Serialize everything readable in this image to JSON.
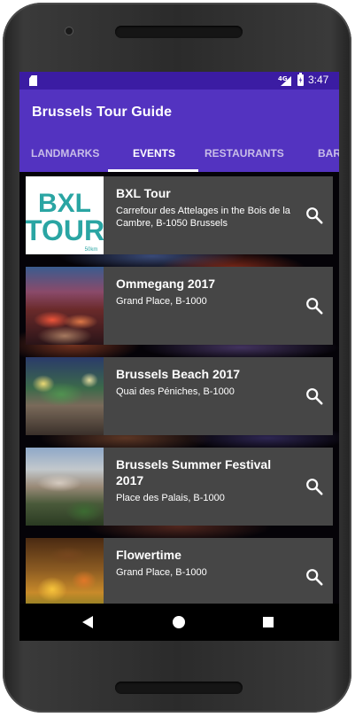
{
  "status_bar": {
    "network": "4G",
    "time": "3:47"
  },
  "app_bar": {
    "title": "Brussels Tour Guide"
  },
  "tabs": [
    {
      "label": "LANDMARKS",
      "active": false
    },
    {
      "label": "EVENTS",
      "active": true
    },
    {
      "label": "RESTAURANTS",
      "active": false
    },
    {
      "label": "BAR",
      "active": false
    }
  ],
  "events": [
    {
      "title": "BXL Tour",
      "address": "Carrefour des Attelages in the Bois de la Cambre, B-1050 Brussels",
      "thumb_logo": [
        "BXL",
        "TOUR",
        "50km"
      ]
    },
    {
      "title": "Ommegang 2017",
      "address": "Grand Place, B-1000"
    },
    {
      "title": "Brussels Beach 2017",
      "address": "Quai des Péniches, B-1000"
    },
    {
      "title": "Brussels Summer Festival 2017",
      "address": "Place des Palais, B-1000"
    },
    {
      "title": "Flowertime",
      "address": "Grand Place, B-1000"
    }
  ],
  "colors": {
    "status_bar": "#3b1ca3",
    "app_bar": "#5333c0",
    "card_background": "#464646",
    "tab_inactive": "#c8bde8"
  },
  "icons": {
    "search": "search-icon",
    "back": "back-icon",
    "home": "home-icon",
    "recents": "recents-icon"
  }
}
